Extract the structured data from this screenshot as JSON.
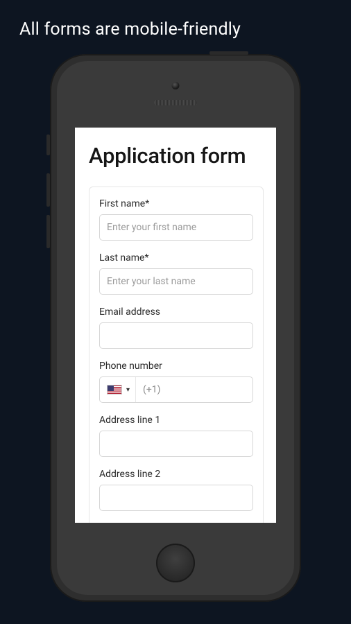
{
  "headline": "All forms are mobile-friendly",
  "form": {
    "title": "Application form",
    "fields": {
      "first_name": {
        "label": "First name*",
        "placeholder": "Enter your first name",
        "value": ""
      },
      "last_name": {
        "label": "Last name*",
        "placeholder": "Enter your last name",
        "value": ""
      },
      "email": {
        "label": "Email address",
        "placeholder": "",
        "value": ""
      },
      "phone": {
        "label": "Phone number",
        "dial_code": "(+1)",
        "country": "US",
        "value": ""
      },
      "address1": {
        "label": "Address line 1",
        "placeholder": "",
        "value": ""
      },
      "address2": {
        "label": "Address line 2",
        "placeholder": "",
        "value": ""
      }
    }
  }
}
